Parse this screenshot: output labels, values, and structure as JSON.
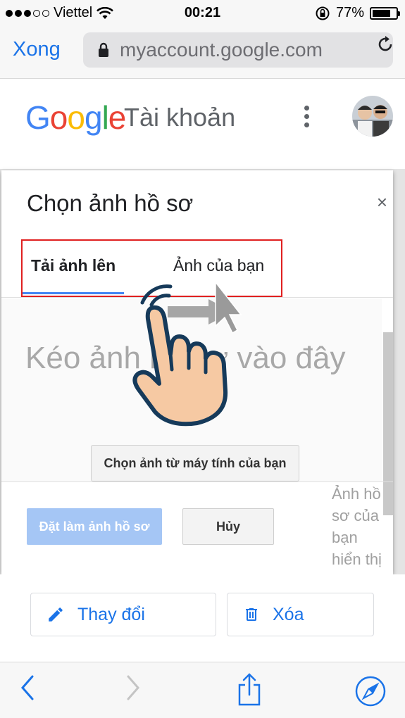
{
  "status_bar": {
    "carrier": "Viettel",
    "time": "00:21",
    "battery": "77%"
  },
  "browser": {
    "done_label": "Xong",
    "url": "myaccount.google.com"
  },
  "header": {
    "logo_text": "Google",
    "title": "Tài khoản"
  },
  "dialog": {
    "title": "Chọn ảnh hồ sơ",
    "close_label": "×",
    "tabs": [
      {
        "label": "Tải ảnh lên",
        "active": true
      },
      {
        "label": "Ảnh của bạn",
        "active": false
      }
    ],
    "drop_text": "Kéo ảnh hồ sơ vào đây",
    "choose_button": "Chọn ảnh từ máy tính của bạn",
    "set_button": "Đặt làm ảnh hồ sơ",
    "cancel_button": "Hủy",
    "side_note": "Ảnh hồ sơ của bạn hiển thị"
  },
  "actions": {
    "change_label": "Thay đổi",
    "delete_label": "Xóa"
  },
  "colors": {
    "accent": "#1a73e8",
    "highlight_box": "#e02020",
    "tab_underline": "#4285f4",
    "set_button_disabled": "#a5c6f5"
  },
  "icons": [
    "wifi-icon",
    "rotation-lock-icon",
    "battery-icon",
    "lock-icon",
    "reload-icon",
    "more-vert-icon",
    "close-icon",
    "hand-pointer-icon",
    "pencil-icon",
    "trash-icon",
    "back-icon",
    "forward-icon",
    "share-icon",
    "compass-icon"
  ]
}
